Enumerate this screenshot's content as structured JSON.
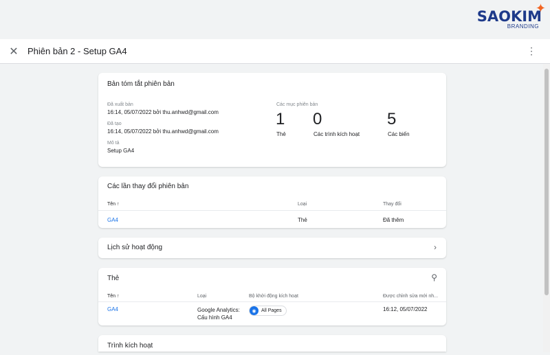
{
  "logo": {
    "text": "SAOKIM",
    "sub": "BRANDING"
  },
  "header": {
    "title": "Phiên bản 2 - Setup GA4"
  },
  "summary": {
    "title": "Bản tóm tắt phiên bản",
    "published_label": "Đã xuất bản",
    "published_value": "16:14, 05/07/2022 bởi thu.anhwd@gmail.com",
    "created_label": "Đã tạo",
    "created_value": "16:14, 05/07/2022 bởi thu.anhwd@gmail.com",
    "desc_label": "Mô tả",
    "desc_value": "Setup GA4",
    "items_label": "Các mục phiên bản",
    "counts": [
      {
        "n": "1",
        "label": "Thẻ"
      },
      {
        "n": "0",
        "label": "Các trình kích hoạt"
      },
      {
        "n": "5",
        "label": "Các biến"
      }
    ]
  },
  "changes": {
    "title": "Các lần thay đổi phiên bản",
    "cols": [
      "Tên ↑",
      "Loại",
      "Thay đổi"
    ],
    "rows": [
      {
        "name": "GA4",
        "type": "Thẻ",
        "change": "Đã thêm"
      }
    ]
  },
  "history": {
    "title": "Lịch sử hoạt động"
  },
  "tags": {
    "title": "Thẻ",
    "cols": [
      "Tên ↑",
      "Loại",
      "Bộ khởi động kích hoạt",
      "Được chỉnh sửa mới nh..."
    ],
    "rows": [
      {
        "name": "GA4",
        "type1": "Google Analytics:",
        "type2": "Cấu hình GA4",
        "trigger": "All Pages",
        "edited": "16:12, 05/07/2022"
      }
    ]
  },
  "triggers": {
    "title": "Trình kích hoạt"
  }
}
